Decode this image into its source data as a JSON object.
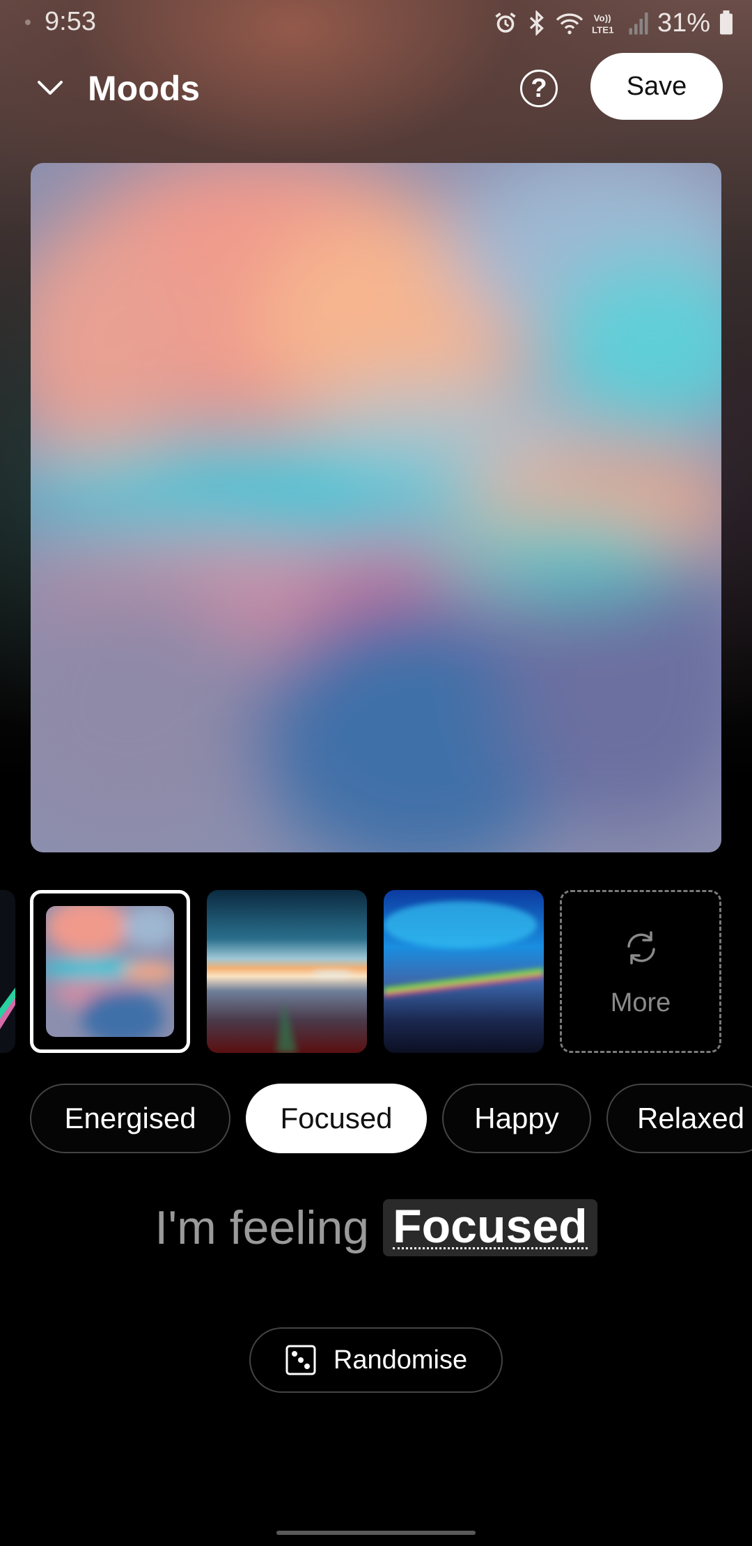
{
  "status_bar": {
    "time": "9:53",
    "battery": "31%",
    "icons": [
      "alarm-icon",
      "bluetooth-icon",
      "wifi-icon",
      "volte-icon",
      "signal-icon",
      "battery-icon"
    ]
  },
  "header": {
    "title": "Moods",
    "help_label": "?",
    "save_label": "Save"
  },
  "thumbnails": {
    "selected_index": 0,
    "more_label": "More"
  },
  "moods": {
    "chips": [
      "Energised",
      "Focused",
      "Happy",
      "Relaxed"
    ],
    "active": "Focused"
  },
  "feeling": {
    "lead": "I'm feeling",
    "mood": "Focused"
  },
  "randomise": {
    "label": "Randomise"
  }
}
